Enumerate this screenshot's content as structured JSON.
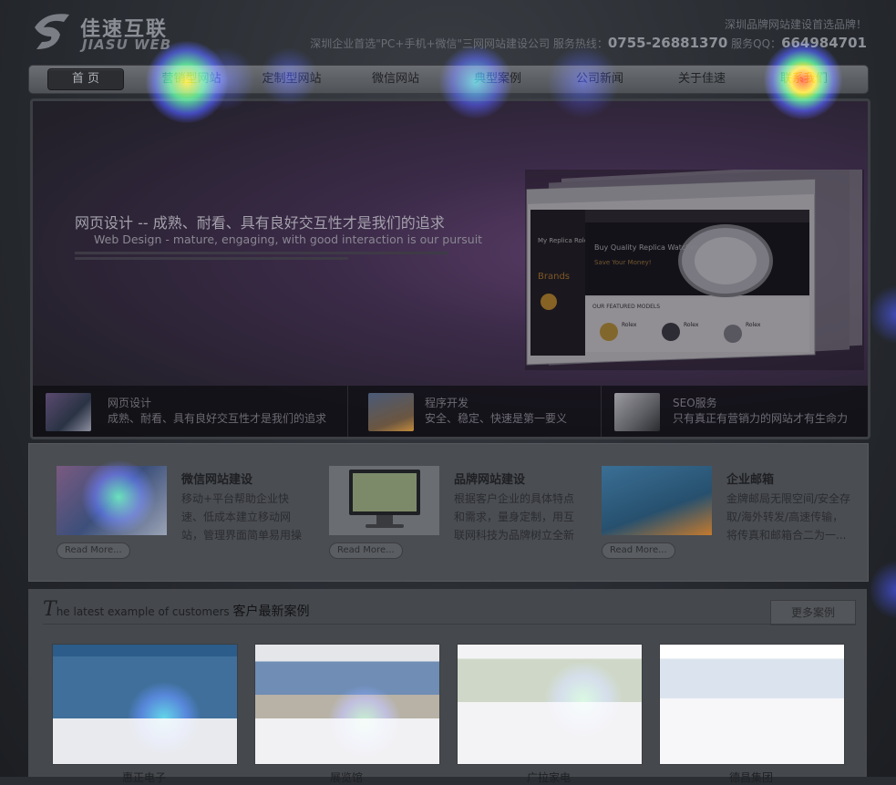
{
  "brand": {
    "name_cn": "佳速互联",
    "name_en": "JIASU WEB"
  },
  "header": {
    "tagline": "深圳品牌网站建设首选品牌！",
    "intro": "深圳企业首选\"PC+手机+微信\"三网网站建设公司 服务热线：",
    "phone": "0755-26881370",
    "qq_label": "服务QQ：",
    "qq": "664984701"
  },
  "nav": {
    "items": [
      {
        "label": "首 页"
      },
      {
        "label": "营销型网站"
      },
      {
        "label": "定制型网站"
      },
      {
        "label": "微信网站"
      },
      {
        "label": "典型案例"
      },
      {
        "label": "公司新闻"
      },
      {
        "label": "关于佳速"
      },
      {
        "label": "联系我们"
      }
    ]
  },
  "banner": {
    "headline": "网页设计 -- 成熟、耐看、具有良好交互性才是我们的追求",
    "subline": "Web Design - mature, engaging, with good interaction is our pursuit",
    "mock_text": {
      "brand": "My Replica Rolex",
      "brands": "Brands",
      "promo": "Buy Quality Replica Watches",
      "save": "Save Your Money!",
      "featured": "OUR FEATURED MODELS",
      "product_name": "Rolex"
    },
    "features": [
      {
        "title": "网页设计",
        "desc": "成熟、耐看、具有良好交互性才是我们的追求"
      },
      {
        "title": "程序开发",
        "desc": "安全、稳定、快速是第一要义"
      },
      {
        "title": "SEO服务",
        "desc": "只有真正有营销力的网站才有生命力"
      }
    ]
  },
  "services": [
    {
      "title": "微信网站建设",
      "desc": "移动+平台帮助企业快速、低成本建立移动网站，管理界面简单易用操",
      "button": "Read More..."
    },
    {
      "title": "品牌网站建设",
      "desc": "根据客户企业的具体特点和需求，量身定制，用互联网科技为品牌树立全新",
      "button": "Read More..."
    },
    {
      "title": "企业邮箱",
      "desc": "金牌邮局无限空间/安全存取/海外转发/高速传输，将传真和邮箱合二为一...",
      "button": "Read More..."
    }
  ],
  "cases": {
    "title_lead": "T",
    "title_en": "he latest example of customers",
    "title_cn": "客户最新案例",
    "more": "更多案例",
    "items": [
      {
        "name": "惠正电子"
      },
      {
        "name": "展览馆"
      },
      {
        "name": "广拉家电"
      },
      {
        "name": "德昌集团"
      }
    ]
  },
  "colors": {
    "accent_hot": "#ff2a00",
    "accent_warm": "#ffe100",
    "heat_cool": "#2b39d8"
  }
}
